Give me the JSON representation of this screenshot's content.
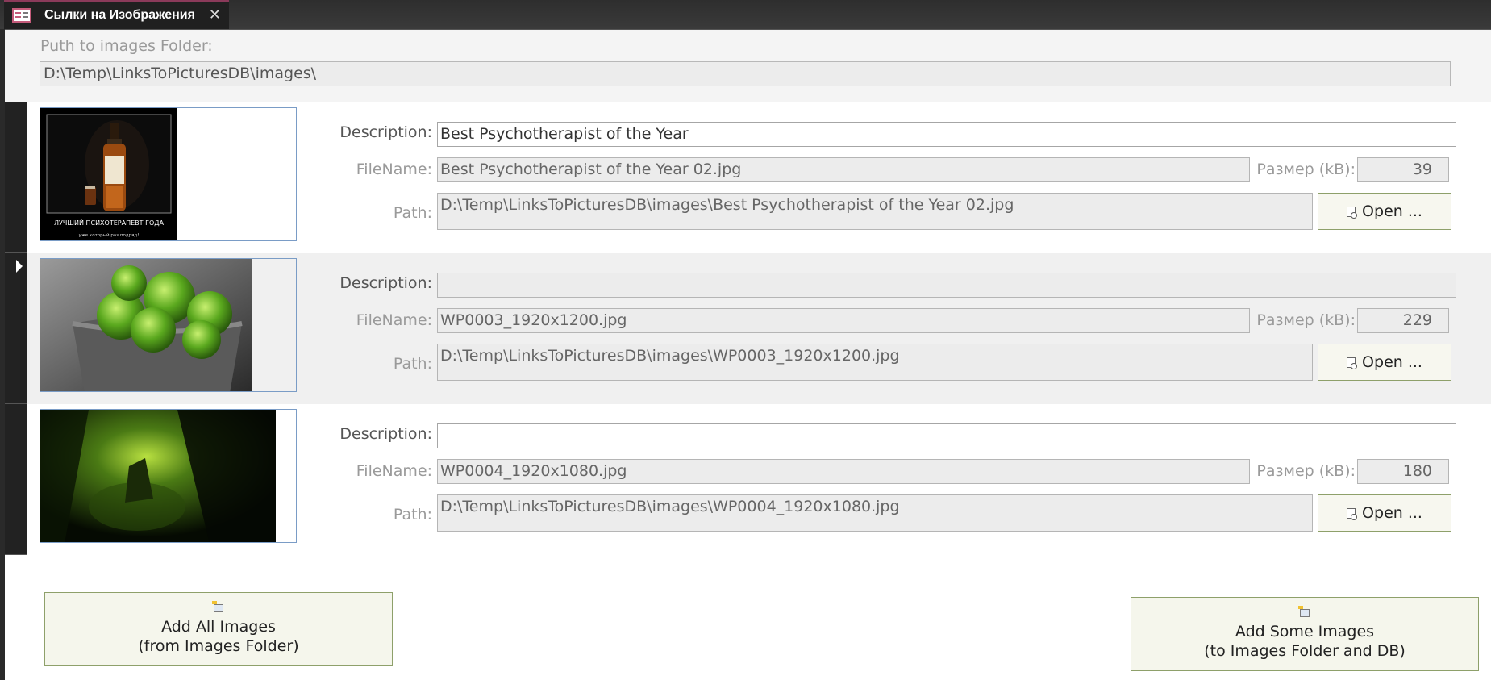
{
  "tab": {
    "title": "Сылки на Изображения",
    "close": "✕"
  },
  "header": {
    "folder_label": "Puth to images Folder:",
    "folder_path": "D:\\Temp\\LinksToPicturesDB\\images\\"
  },
  "labels": {
    "description": "Description:",
    "filename": "FileName:",
    "size": "Размер (kB):",
    "path": "Path:",
    "open": "Open ..."
  },
  "records": [
    {
      "description": "Best Psychotherapist of the Year",
      "filename": "Best Psychotherapist of the Year 02.jpg",
      "size": "39",
      "path": "D:\\Temp\\LinksToPicturesDB\\images\\Best Psychotherapist of the Year 02.jpg",
      "thumb_caption": "ЛУЧШИЙ ПСИХОТЕРАПЕВТ ГОДА",
      "thumb_subcaption": "уже который раз подряд!"
    },
    {
      "description": "",
      "filename": "WP0003_1920x1200.jpg",
      "size": "229",
      "path": "D:\\Temp\\LinksToPicturesDB\\images\\WP0003_1920x1200.jpg"
    },
    {
      "description": "",
      "filename": "WP0004_1920x1080.jpg",
      "size": "180",
      "path": "D:\\Temp\\LinksToPicturesDB\\images\\WP0004_1920x1080.jpg"
    }
  ],
  "buttons": {
    "add_all_line1": "Add All Images",
    "add_all_line2": "(from Images Folder)",
    "add_some_line1": "Add Some Images",
    "add_some_line2": "(to Images Folder and DB)"
  },
  "colors": {
    "tab_accent": "#8b3a5a",
    "button_border": "#8ea06a",
    "thumb_border": "#7a9cc6"
  }
}
